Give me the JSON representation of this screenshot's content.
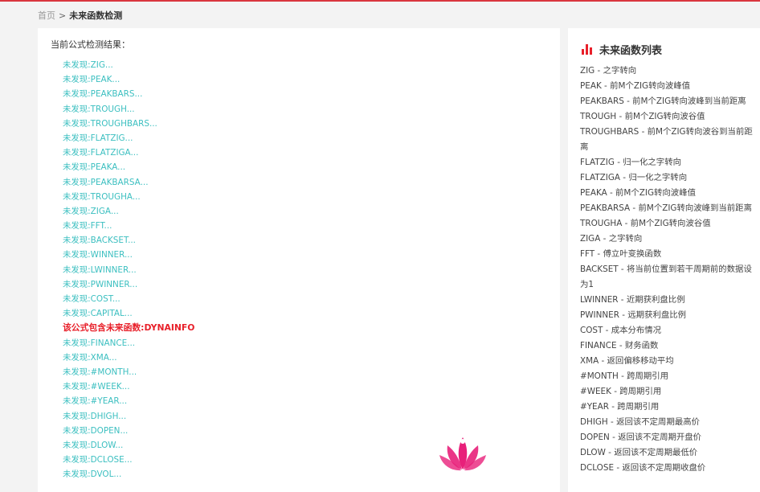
{
  "breadcrumb": {
    "home": "首页",
    "separator": ">",
    "current": "未来函数检测"
  },
  "result": {
    "title": "当前公式检测结果：",
    "items": [
      {
        "text": "未发现:ZIG...",
        "hit": false
      },
      {
        "text": "未发现:PEAK...",
        "hit": false
      },
      {
        "text": "未发现:PEAKBARS...",
        "hit": false
      },
      {
        "text": "未发现:TROUGH...",
        "hit": false
      },
      {
        "text": "未发现:TROUGHBARS...",
        "hit": false
      },
      {
        "text": "未发现:FLATZIG...",
        "hit": false
      },
      {
        "text": "未发现:FLATZIGA...",
        "hit": false
      },
      {
        "text": "未发现:PEAKA...",
        "hit": false
      },
      {
        "text": "未发现:PEAKBARSA...",
        "hit": false
      },
      {
        "text": "未发现:TROUGHA...",
        "hit": false
      },
      {
        "text": "未发现:ZIGA...",
        "hit": false
      },
      {
        "text": "未发现:FFT...",
        "hit": false
      },
      {
        "text": "未发现:BACKSET...",
        "hit": false
      },
      {
        "text": "未发现:WINNER...",
        "hit": false
      },
      {
        "text": "未发现:LWINNER...",
        "hit": false
      },
      {
        "text": "未发现:PWINNER...",
        "hit": false
      },
      {
        "text": "未发现:COST...",
        "hit": false
      },
      {
        "text": "未发现:CAPITAL...",
        "hit": false
      },
      {
        "text": "该公式包含未来函数:DYNAINFO",
        "hit": true
      },
      {
        "text": "未发现:FINANCE...",
        "hit": false
      },
      {
        "text": "未发现:XMA...",
        "hit": false
      },
      {
        "text": "未发现:#MONTH...",
        "hit": false
      },
      {
        "text": "未发现:#WEEK...",
        "hit": false
      },
      {
        "text": "未发现:#YEAR...",
        "hit": false
      },
      {
        "text": "未发现:DHIGH...",
        "hit": false
      },
      {
        "text": "未发现:DOPEN...",
        "hit": false
      },
      {
        "text": "未发现:DLOW...",
        "hit": false
      },
      {
        "text": "未发现:DCLOSE...",
        "hit": false
      },
      {
        "text": "未发现:DVOL...",
        "hit": false
      }
    ]
  },
  "sidebar": {
    "title": "未来函数列表",
    "icon": "bar-chart-icon",
    "functions": [
      "ZIG - 之字转向",
      "PEAK - 前M个ZIG转向波峰值",
      "PEAKBARS - 前M个ZIG转向波峰到当前距离",
      "TROUGH - 前M个ZIG转向波谷值",
      "TROUGHBARS - 前M个ZIG转向波谷到当前距离",
      "FLATZIG - 归一化之字转向",
      "FLATZIGA - 归一化之字转向",
      "PEAKA - 前M个ZIG转向波峰值",
      "PEAKBARSA - 前M个ZIG转向波峰到当前距离",
      "TROUGHA - 前M个ZIG转向波谷值",
      "ZIGA - 之字转向",
      "FFT - 傅立叶变换函数",
      "BACKSET - 将当前位置到若干周期前的数据设为1",
      "LWINNER - 近期获利盘比例",
      "PWINNER - 远期获利盘比例",
      "COST - 成本分布情况",
      "FINANCE - 财务函数",
      "XMA - 返回偏移移动平均",
      "#MONTH - 跨周期引用",
      "#WEEK - 跨周期引用",
      "#YEAR - 跨周期引用",
      "DHIGH - 返回该不定周期最高价",
      "DOPEN - 返回该不定周期开盘价",
      "DLOW - 返回该不定周期最低价",
      "DCLOSE - 返回该不定周期收盘价"
    ]
  },
  "colors": {
    "accent": "#e8202a",
    "ok": "#3bbfc0",
    "watermark": "#e8207a"
  }
}
